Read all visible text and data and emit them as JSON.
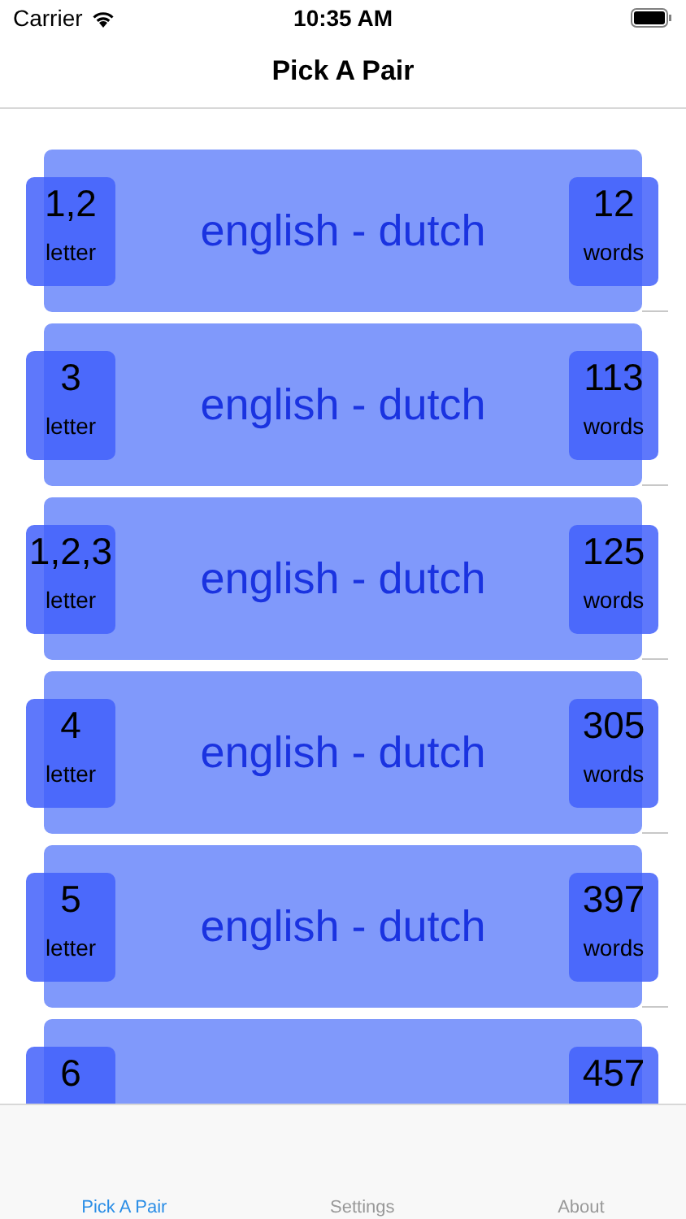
{
  "status_bar": {
    "carrier": "Carrier",
    "time": "10:35 AM"
  },
  "nav": {
    "title": "Pick A Pair"
  },
  "pairs": [
    {
      "letters": "1,2",
      "letters_label": "letter",
      "title": "english - dutch",
      "words": "12",
      "words_label": "words"
    },
    {
      "letters": "3",
      "letters_label": "letter",
      "title": "english - dutch",
      "words": "113",
      "words_label": "words"
    },
    {
      "letters": "1,2,3",
      "letters_label": "letter",
      "title": "english - dutch",
      "words": "125",
      "words_label": "words"
    },
    {
      "letters": "4",
      "letters_label": "letter",
      "title": "english - dutch",
      "words": "305",
      "words_label": "words"
    },
    {
      "letters": "5",
      "letters_label": "letter",
      "title": "english - dutch",
      "words": "397",
      "words_label": "words"
    },
    {
      "letters": "6",
      "words": "457"
    }
  ],
  "tabs": [
    {
      "label": "Pick A Pair",
      "selected": true
    },
    {
      "label": "Settings",
      "selected": false
    },
    {
      "label": "About",
      "selected": false
    }
  ]
}
